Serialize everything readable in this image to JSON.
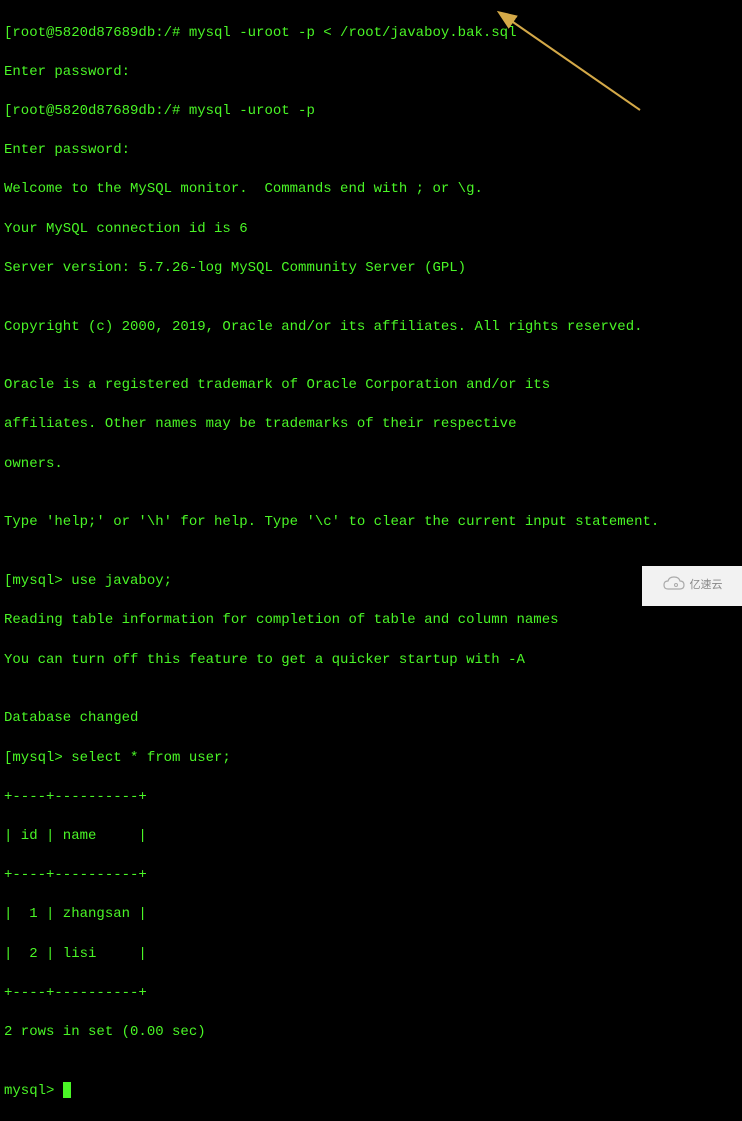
{
  "lines": {
    "l1": "[root@5820d87689db:/# mysql -uroot -p < /root/javaboy.bak.sql",
    "l2": "Enter password:",
    "l3": "[root@5820d87689db:/# mysql -uroot -p",
    "l4": "Enter password:",
    "l5": "Welcome to the MySQL monitor.  Commands end with ; or \\g.",
    "l6": "Your MySQL connection id is 6",
    "l7": "Server version: 5.7.26-log MySQL Community Server (GPL)",
    "l8": "",
    "l9": "Copyright (c) 2000, 2019, Oracle and/or its affiliates. All rights reserved.",
    "l10": "",
    "l11": "Oracle is a registered trademark of Oracle Corporation and/or its",
    "l12": "affiliates. Other names may be trademarks of their respective",
    "l13": "owners.",
    "l14": "",
    "l15": "Type 'help;' or '\\h' for help. Type '\\c' to clear the current input statement.",
    "l16": "",
    "l17": "[mysql> use javaboy;",
    "l18": "Reading table information for completion of table and column names",
    "l19": "You can turn off this feature to get a quicker startup with -A",
    "l20": "",
    "l21": "Database changed",
    "l22": "[mysql> select * from user;",
    "l23": "+----+----------+",
    "l24": "| id | name     |",
    "l25": "+----+----------+",
    "l26": "|  1 | zhangsan |",
    "l27": "|  2 | lisi     |",
    "l28": "+----+----------+",
    "l29": "2 rows in set (0.00 sec)",
    "l30": "",
    "l31": "mysql> "
  },
  "table_data": {
    "columns": [
      "id",
      "name"
    ],
    "rows": [
      {
        "id": 1,
        "name": "zhangsan"
      },
      {
        "id": 2,
        "name": "lisi"
      }
    ],
    "row_count": 2,
    "query_time_sec": "0.00"
  },
  "commands": {
    "restore": "mysql -uroot -p < /root/javaboy.bak.sql",
    "login": "mysql -uroot -p",
    "use_db": "use javaboy;",
    "select": "select * from user;"
  },
  "prompt": {
    "shell": "root@5820d87689db:/#",
    "mysql": "mysql>"
  },
  "server": {
    "connection_id": "6",
    "version": "5.7.26-log",
    "product": "MySQL Community Server (GPL)"
  },
  "watermark": {
    "text": "亿速云"
  },
  "arrow_color": "#d4a948"
}
